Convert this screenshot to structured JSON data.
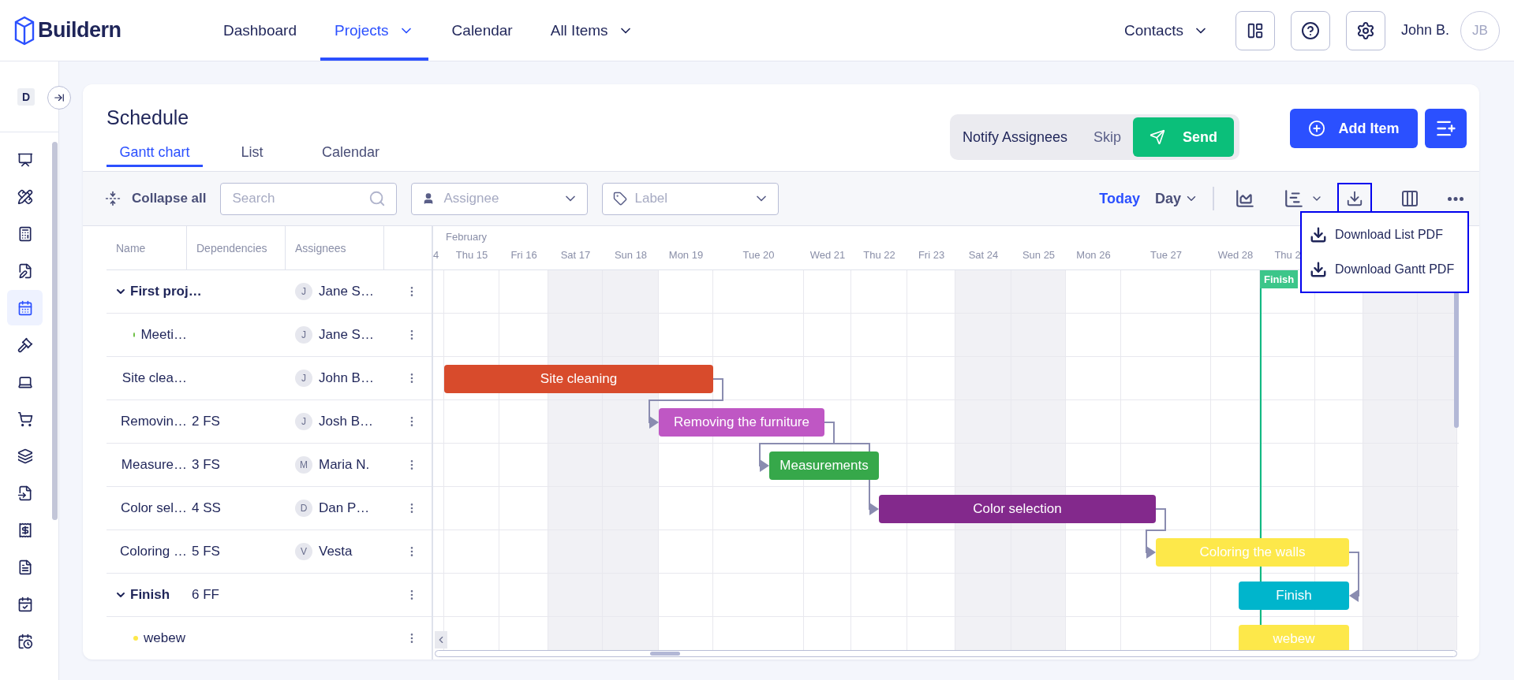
{
  "brand": {
    "name": "Buildern"
  },
  "nav": [
    {
      "label": "Dashboard",
      "selected": false,
      "dropdown": false
    },
    {
      "label": "Projects",
      "selected": true,
      "dropdown": true
    },
    {
      "label": "Calendar",
      "selected": false,
      "dropdown": false
    },
    {
      "label": "All Items",
      "selected": false,
      "dropdown": true
    }
  ],
  "account": {
    "contacts": "Contacts",
    "user_name": "John B.",
    "user_initials": "JB"
  },
  "sidebar": {
    "project_badge": "D",
    "items": [
      {
        "selected": false
      },
      {
        "selected": false
      },
      {
        "selected": false
      },
      {
        "selected": false
      },
      {
        "selected": true
      },
      {
        "selected": false
      },
      {
        "selected": false
      },
      {
        "selected": false
      },
      {
        "selected": false
      },
      {
        "selected": false
      },
      {
        "selected": false
      },
      {
        "selected": false
      },
      {
        "selected": false
      },
      {
        "selected": false
      }
    ]
  },
  "schedule": {
    "title": "Schedule",
    "tabs": [
      {
        "label": "Gantt chart",
        "selected": true
      },
      {
        "label": "List",
        "selected": false
      },
      {
        "label": "Calendar",
        "selected": false
      }
    ]
  },
  "notify": {
    "label": "Notify Assignees",
    "skip": "Skip",
    "send": "Send"
  },
  "add_item": "Add Item",
  "toolbar": {
    "collapse": "Collapse all",
    "search": {
      "placeholder": "Search"
    },
    "assignee": {
      "placeholder": "Assignee"
    },
    "label": {
      "placeholder": "Label"
    },
    "today": "Today",
    "scale": "Day"
  },
  "download_menu": {
    "items": [
      "Download List PDF",
      "Download Gantt PDF"
    ]
  },
  "table": {
    "columns": [
      "Name",
      "Dependencies",
      "Assignees"
    ],
    "rows": [
      {
        "name": "First proj…",
        "expanded": true,
        "initial": "J",
        "assignee": "Jane S…",
        "children": [
          {
            "name": "Meeti…",
            "color": "#6cbf43",
            "initial": "J",
            "assignee": "Jane S…"
          }
        ]
      },
      {
        "name": "Site clea…",
        "initial": "J",
        "assignee": "John B…",
        "bar": {
          "label": "Site cleaning",
          "color": "#d84b2c"
        }
      },
      {
        "name": "Removin…",
        "dependency": "2 FS",
        "initial": "J",
        "assignee": "Josh B…",
        "bar": {
          "label": "Removing the furniture",
          "color": "#bf57c4"
        }
      },
      {
        "name": "Measure…",
        "dependency": "3 FS",
        "initial": "M",
        "assignee": "Maria N.",
        "bar": {
          "label": "Measurements",
          "color": "#36a84a"
        }
      },
      {
        "name": "Color sel…",
        "dependency": "4 SS",
        "initial": "D",
        "assignee": "Dan P…",
        "bar": {
          "label": "Color selection",
          "color": "#83298c"
        }
      },
      {
        "name": "Coloring …",
        "dependency": "5 FS",
        "initial": "V",
        "assignee": "Vesta",
        "bar": {
          "label": "Coloring the walls",
          "color": "#fde84a"
        }
      },
      {
        "name": "Finish",
        "dependency": "6 FF",
        "expanded": true,
        "bar": {
          "label": "Finish",
          "color": "#00b5cc"
        },
        "children": [
          {
            "name": "webew",
            "color": "#fde84a",
            "bar": {
              "label": "webew",
              "color": "#fde84a"
            }
          }
        ]
      }
    ]
  },
  "timeline": {
    "month": "February",
    "marker": "Finish",
    "days": [
      {
        "label": "4",
        "weekend": false
      },
      {
        "label": "Thu 15",
        "weekend": false
      },
      {
        "label": "Fri 16",
        "weekend": false
      },
      {
        "label": "Sat 17",
        "weekend": true
      },
      {
        "label": "Sun 18",
        "weekend": true
      },
      {
        "label": "Mon 19",
        "weekend": false
      },
      {
        "label": "Tue 20",
        "weekend": false
      },
      {
        "label": "Wed 21",
        "weekend": false
      },
      {
        "label": "Thu 22",
        "weekend": false
      },
      {
        "label": "Fri 23",
        "weekend": false
      },
      {
        "label": "Sat 24",
        "weekend": true
      },
      {
        "label": "Sun 25",
        "weekend": true
      },
      {
        "label": "Mon 26",
        "weekend": false
      },
      {
        "label": "Tue 27",
        "weekend": false
      },
      {
        "label": "Wed 28",
        "weekend": false
      },
      {
        "label": "Thu 2",
        "weekend": false
      },
      {
        "weekend": false
      },
      {
        "weekend": true
      },
      {
        "weekend": true
      }
    ]
  }
}
